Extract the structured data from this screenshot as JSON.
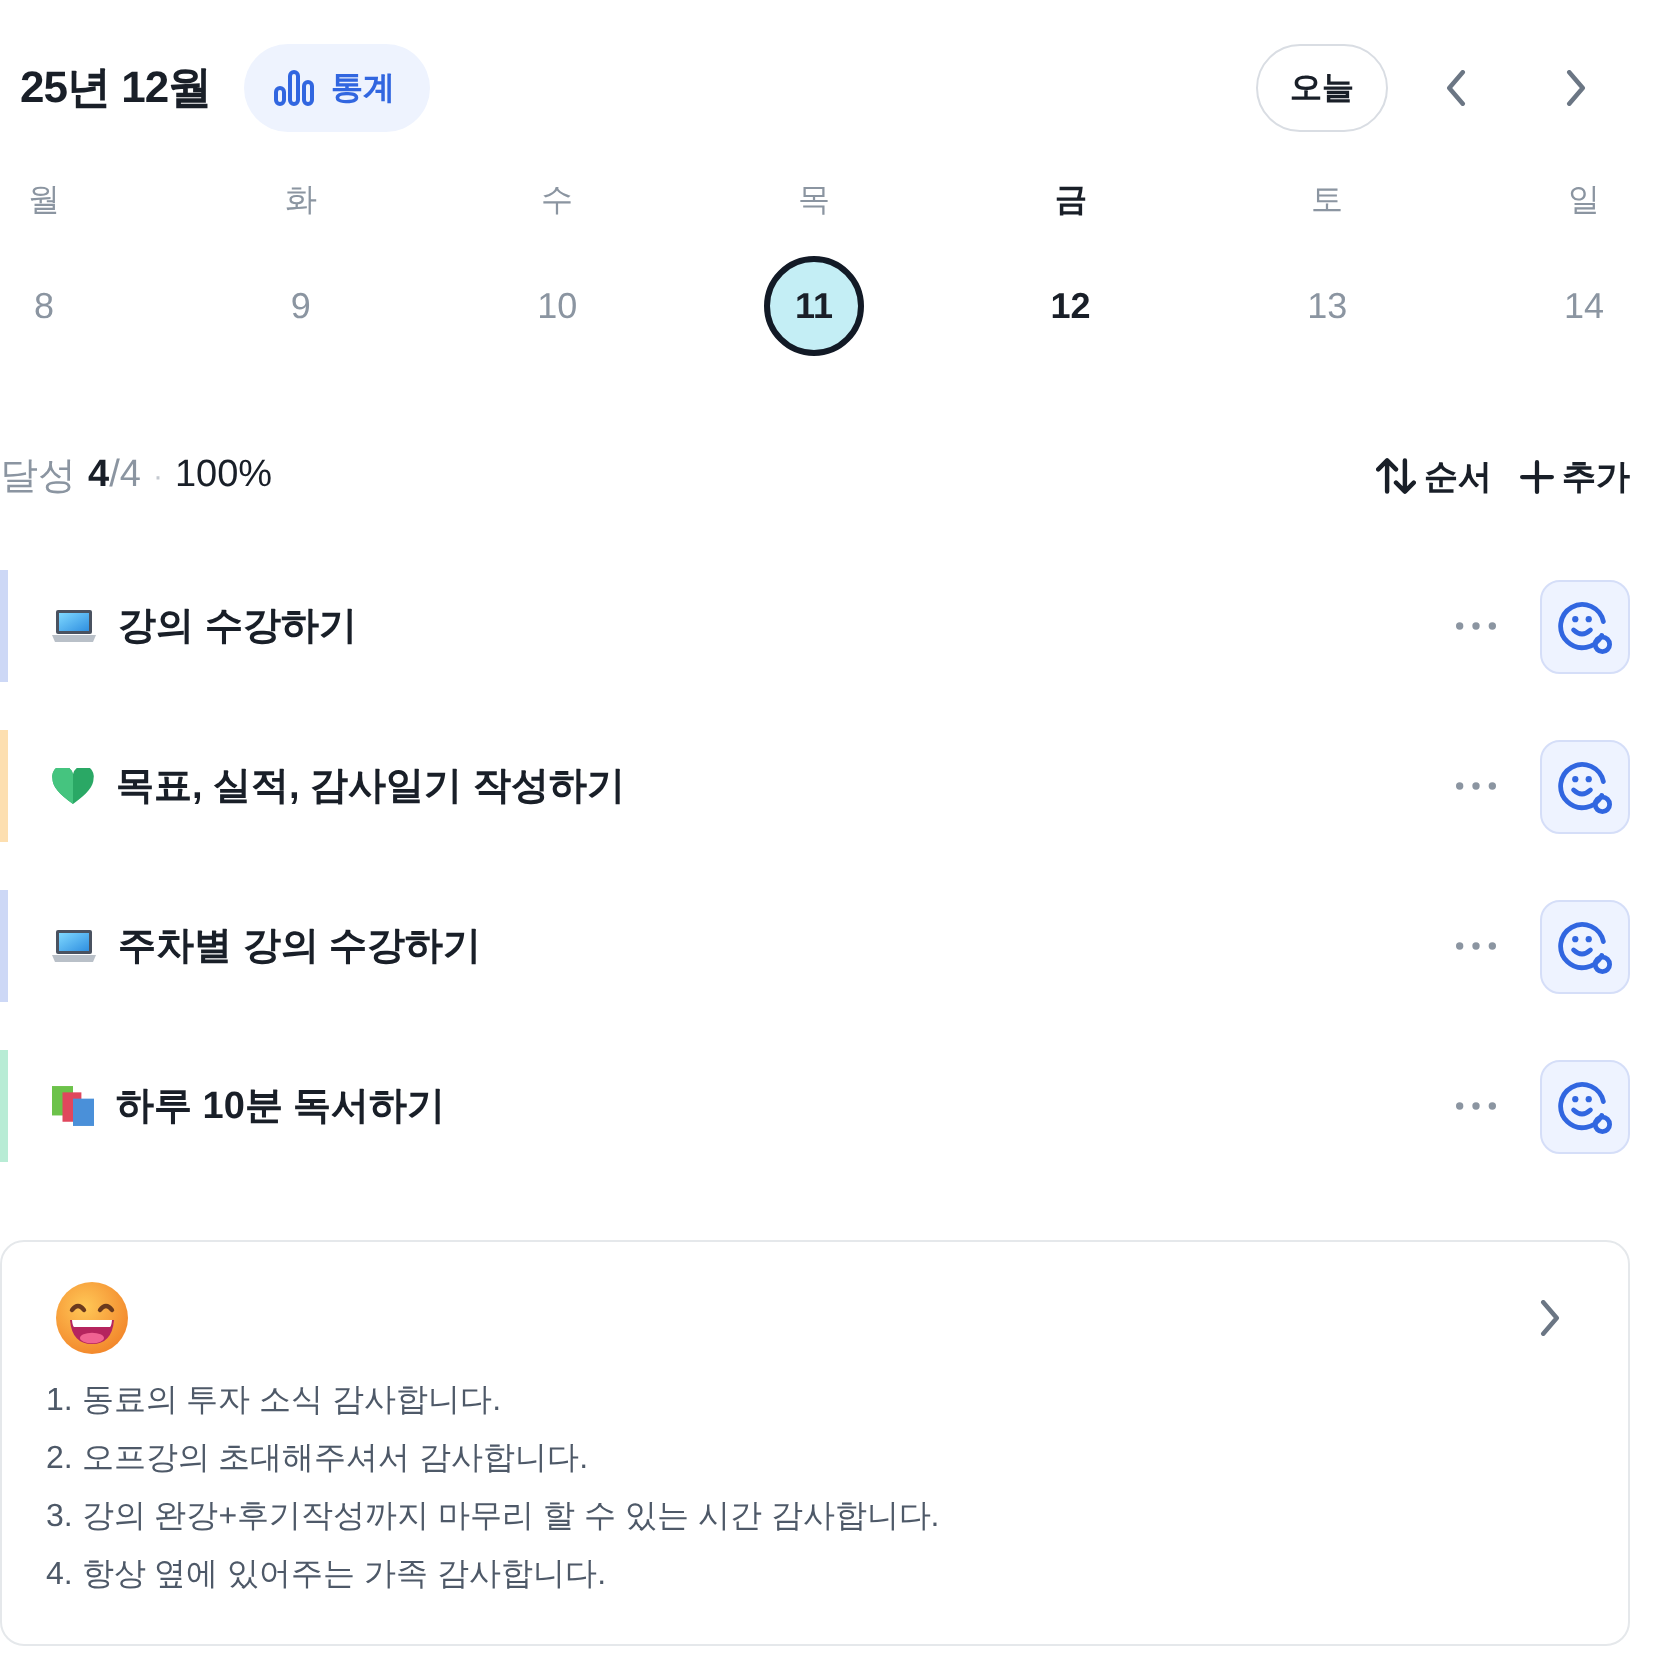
{
  "header": {
    "title": "25년 12월",
    "stats_button": "통계",
    "today_button": "오늘"
  },
  "days": [
    {
      "weekday": "월",
      "date": "8",
      "selected": false,
      "today": false
    },
    {
      "weekday": "화",
      "date": "9",
      "selected": false,
      "today": false
    },
    {
      "weekday": "수",
      "date": "10",
      "selected": false,
      "today": false
    },
    {
      "weekday": "목",
      "date": "11",
      "selected": true,
      "today": false
    },
    {
      "weekday": "금",
      "date": "12",
      "selected": false,
      "today": true
    },
    {
      "weekday": "토",
      "date": "13",
      "selected": false,
      "today": false
    },
    {
      "weekday": "일",
      "date": "14",
      "selected": false,
      "today": false
    }
  ],
  "progress": {
    "label": "달성",
    "count": "**4**/4",
    "separator": "·",
    "percent": "100%"
  },
  "actions": {
    "sort": "순서",
    "add": "추가"
  },
  "tasks": [
    {
      "kind": "laptop",
      "title": "강의 수강하기",
      "color": "#cdd8f6"
    },
    {
      "kind": "heart",
      "title": "목표, 실적, 감사일기 작성하기",
      "color": "#fddfb0"
    },
    {
      "kind": "laptop",
      "title": "주차별 강의 수강하기",
      "color": "#cdd8f6"
    },
    {
      "kind": "books",
      "title": "하루 10분 독서하기",
      "color": "#b8ecd5"
    }
  ],
  "gratitude": {
    "lines": [
      "1. 동료의 투자 소식 감사합니다.",
      "2. 오프강의 초대해주셔서 감사합니다.",
      "3. 강의 완강+후기작성까지 마무리 할 수 있는 시간 감사합니다.",
      "4. 항상 옆에 있어주는 가족 감사합니다."
    ]
  }
}
